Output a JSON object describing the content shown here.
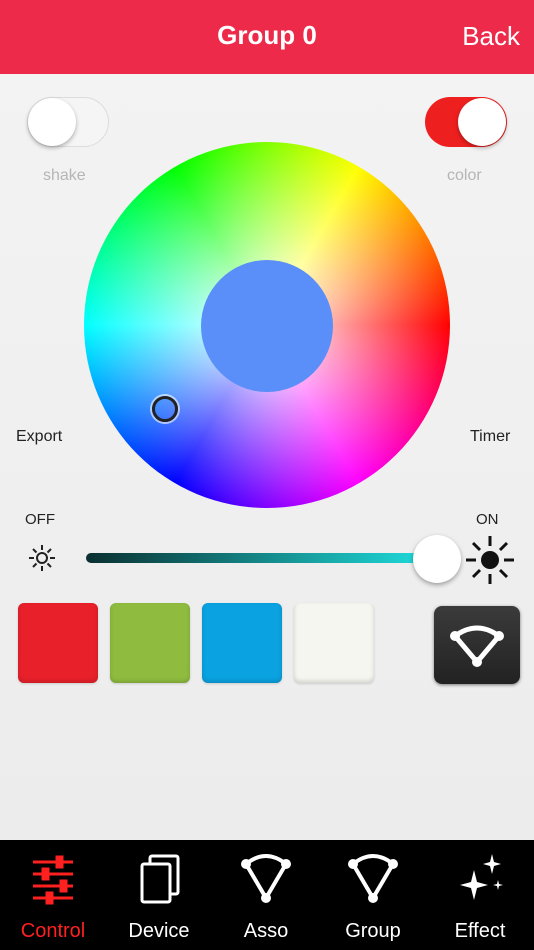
{
  "header": {
    "title": "Group 0",
    "back_label": "Back",
    "background": "#ee2a4a"
  },
  "toggles": {
    "shake": {
      "label": "shake",
      "state": "off"
    },
    "color": {
      "label": "color",
      "state": "on",
      "color": "#ee1f1f"
    }
  },
  "side_labels": {
    "left": "Export",
    "right": "Timer"
  },
  "color_wheel": {
    "selected_color": "#5a8ef8"
  },
  "brightness": {
    "off_label": "OFF",
    "on_label": "ON",
    "value_percent": 100
  },
  "presets": [
    {
      "color": "#e8202a",
      "icon": "red-swatch"
    },
    {
      "color": "#8fbc3f",
      "icon": "green-swatch"
    },
    {
      "color": "#0aa2e0",
      "icon": "blue-swatch"
    },
    {
      "color": "#f6f6f0",
      "icon": "white-swatch"
    }
  ],
  "mode_button": {
    "icon": "triangle-nodes-icon"
  },
  "tabbar": {
    "active": "Control",
    "items": [
      {
        "label": "Control",
        "icon": "sliders-icon"
      },
      {
        "label": "Device",
        "icon": "cards-icon"
      },
      {
        "label": "Asso",
        "icon": "triangle-nodes-icon"
      },
      {
        "label": "Group",
        "icon": "triangle-nodes-icon"
      },
      {
        "label": "Effect",
        "icon": "sparkles-icon"
      }
    ]
  }
}
